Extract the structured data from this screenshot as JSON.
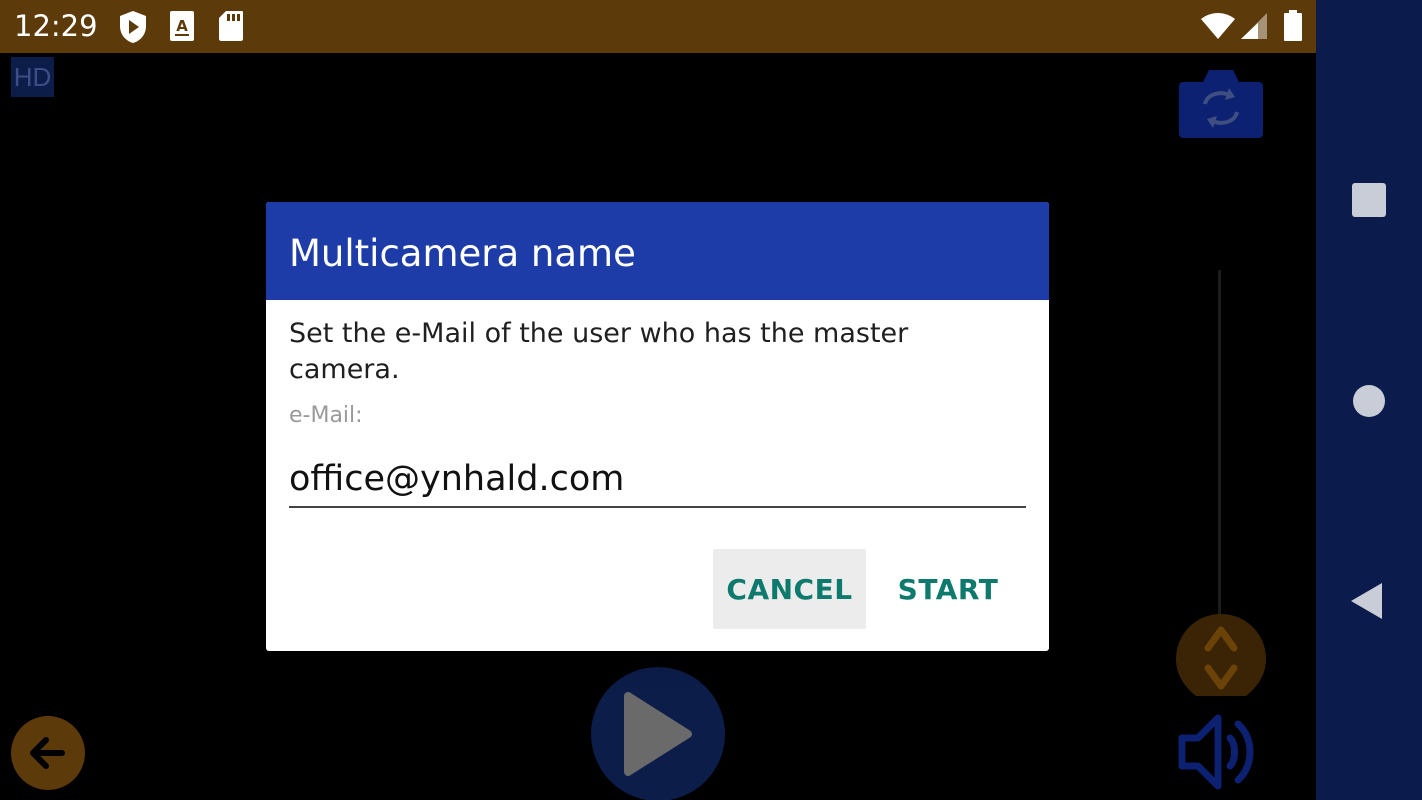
{
  "status_bar": {
    "time": "12:29",
    "icons": [
      "shield-play-icon",
      "a-box-icon",
      "sd-card-icon",
      "wifi-icon",
      "signal-icon",
      "battery-icon"
    ]
  },
  "camera": {
    "hd_badge": "HD",
    "controls": [
      "switch-camera-icon",
      "zoom-knob-icon",
      "back-arrow-icon",
      "play-icon",
      "volume-icon"
    ]
  },
  "dialog": {
    "title": "Multicamera name",
    "message": "Set the e-Mail of the user who has the master camera.",
    "field_label": "e-Mail:",
    "email_value": "office@ynhald.com",
    "cancel_label": "CANCEL",
    "start_label": "START"
  },
  "nav_bar": {
    "icons": [
      "recents-icon",
      "home-icon",
      "back-icon"
    ]
  },
  "colors": {
    "status_bar": "#5c3a09",
    "dialog_header": "#1e3ca7",
    "button_text": "#0d7a6d",
    "nav_bar": "#0b1c4c"
  }
}
